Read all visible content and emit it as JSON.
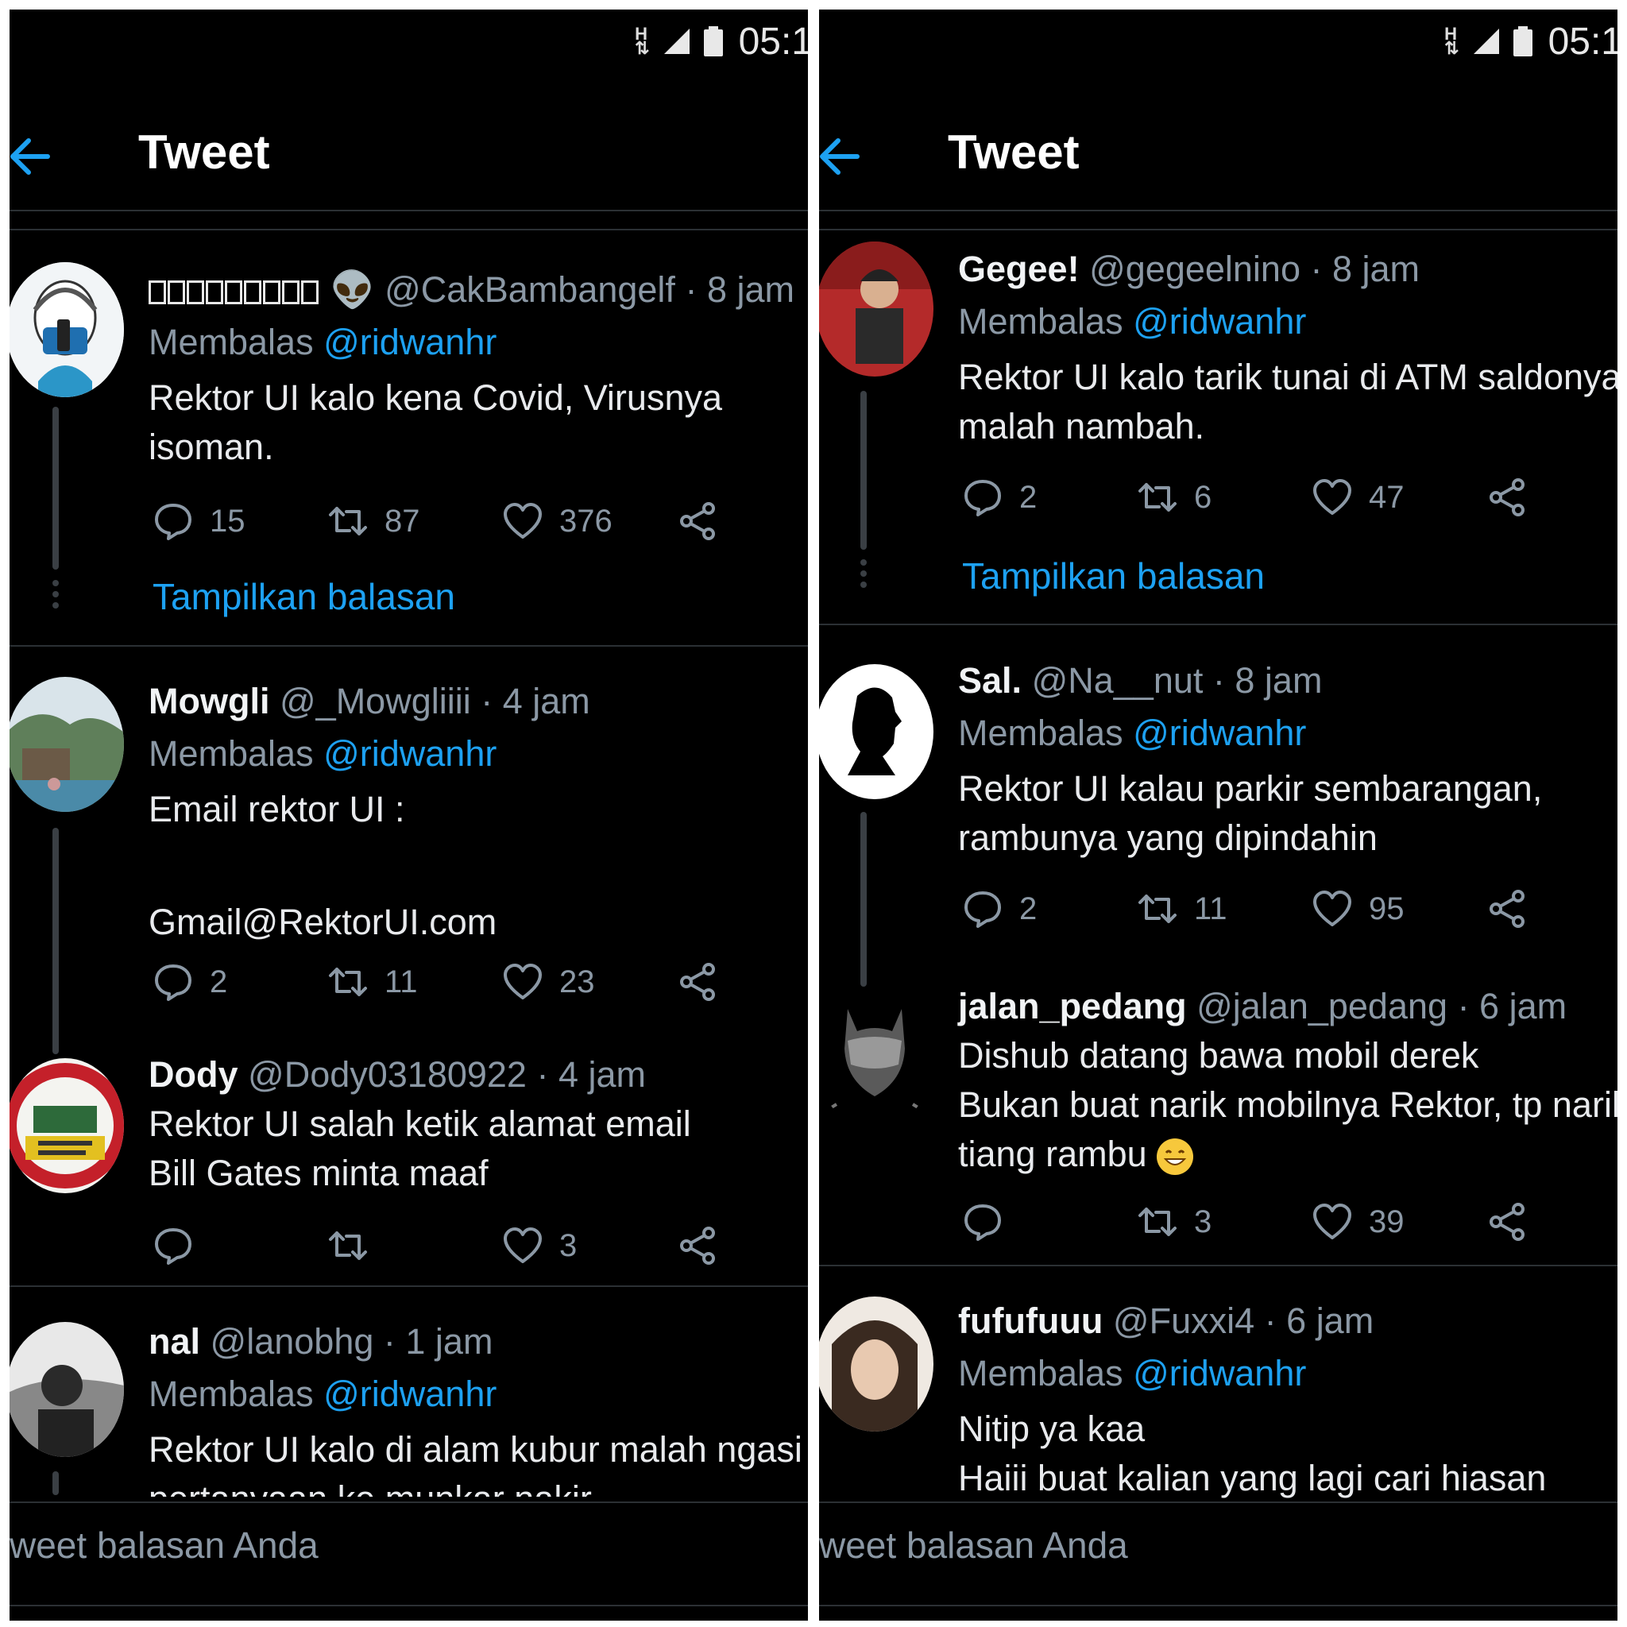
{
  "status": {
    "h": "H",
    "time": "05:1"
  },
  "header": {
    "title": "Tweet"
  },
  "reply_label": "Membalas",
  "show_replies": "Tampilkan balasan",
  "compose_placeholder": "weet balasan Anda",
  "left": [
    {
      "name": "",
      "handle": "@CakBambangelf",
      "time": "· 8 jam",
      "reply_to": "@ridwanhr",
      "lines": [
        "Rektor UI kalo kena Covid, Virusnya",
        "isoman."
      ],
      "replies": "15",
      "retweets": "87",
      "likes": "376"
    },
    {
      "name": "Mowgli",
      "handle": "@_Mowgliiii",
      "time": "· 4 jam",
      "reply_to": "@ridwanhr",
      "lines": [
        "Email rektor UI :",
        "",
        "Gmail@RektorUI.com"
      ],
      "replies": "2",
      "retweets": "11",
      "likes": "23"
    },
    {
      "name": "Dody",
      "handle": "@Dody03180922",
      "time": "· 4 jam",
      "lines": [
        "Rektor UI salah ketik alamat email",
        "Bill Gates minta maaf"
      ],
      "replies": "",
      "retweets": "",
      "likes": "3"
    },
    {
      "name": "nal",
      "handle": "@lanobhg",
      "time": "· 1 jam",
      "reply_to": "@ridwanhr",
      "lines": [
        "Rektor UI kalo di alam kubur malah ngasi",
        "pertanyaan ke munkar nakir"
      ]
    }
  ],
  "right": [
    {
      "name": "Gegee!",
      "handle": "@gegeelnino",
      "time": "· 8 jam",
      "reply_to": "@ridwanhr",
      "lines": [
        "Rektor UI kalo tarik tunai di ATM saldonya",
        "malah nambah."
      ],
      "replies": "2",
      "retweets": "6",
      "likes": "47"
    },
    {
      "name": "Sal.",
      "handle": "@Na__nut",
      "time": "· 8 jam",
      "reply_to": "@ridwanhr",
      "lines": [
        "Rektor UI kalau parkir sembarangan,",
        "rambunya yang dipindahin"
      ],
      "replies": "2",
      "retweets": "11",
      "likes": "95"
    },
    {
      "name": "jalan_pedang",
      "handle": "@jalan_pedang",
      "time": "· 6 jam",
      "lines": [
        "Dishub datang bawa mobil derek",
        "Bukan buat narik mobilnya Rektor, tp narik",
        "tiang rambu"
      ],
      "replies": "",
      "retweets": "3",
      "likes": "39"
    },
    {
      "name": "fufufuuu",
      "handle": "@Fuxxi4",
      "time": "· 6 jam",
      "reply_to": "@ridwanhr",
      "lines": [
        "Nitip ya kaa",
        "Haiii buat kalian yang lagi cari hiasan"
      ]
    }
  ]
}
